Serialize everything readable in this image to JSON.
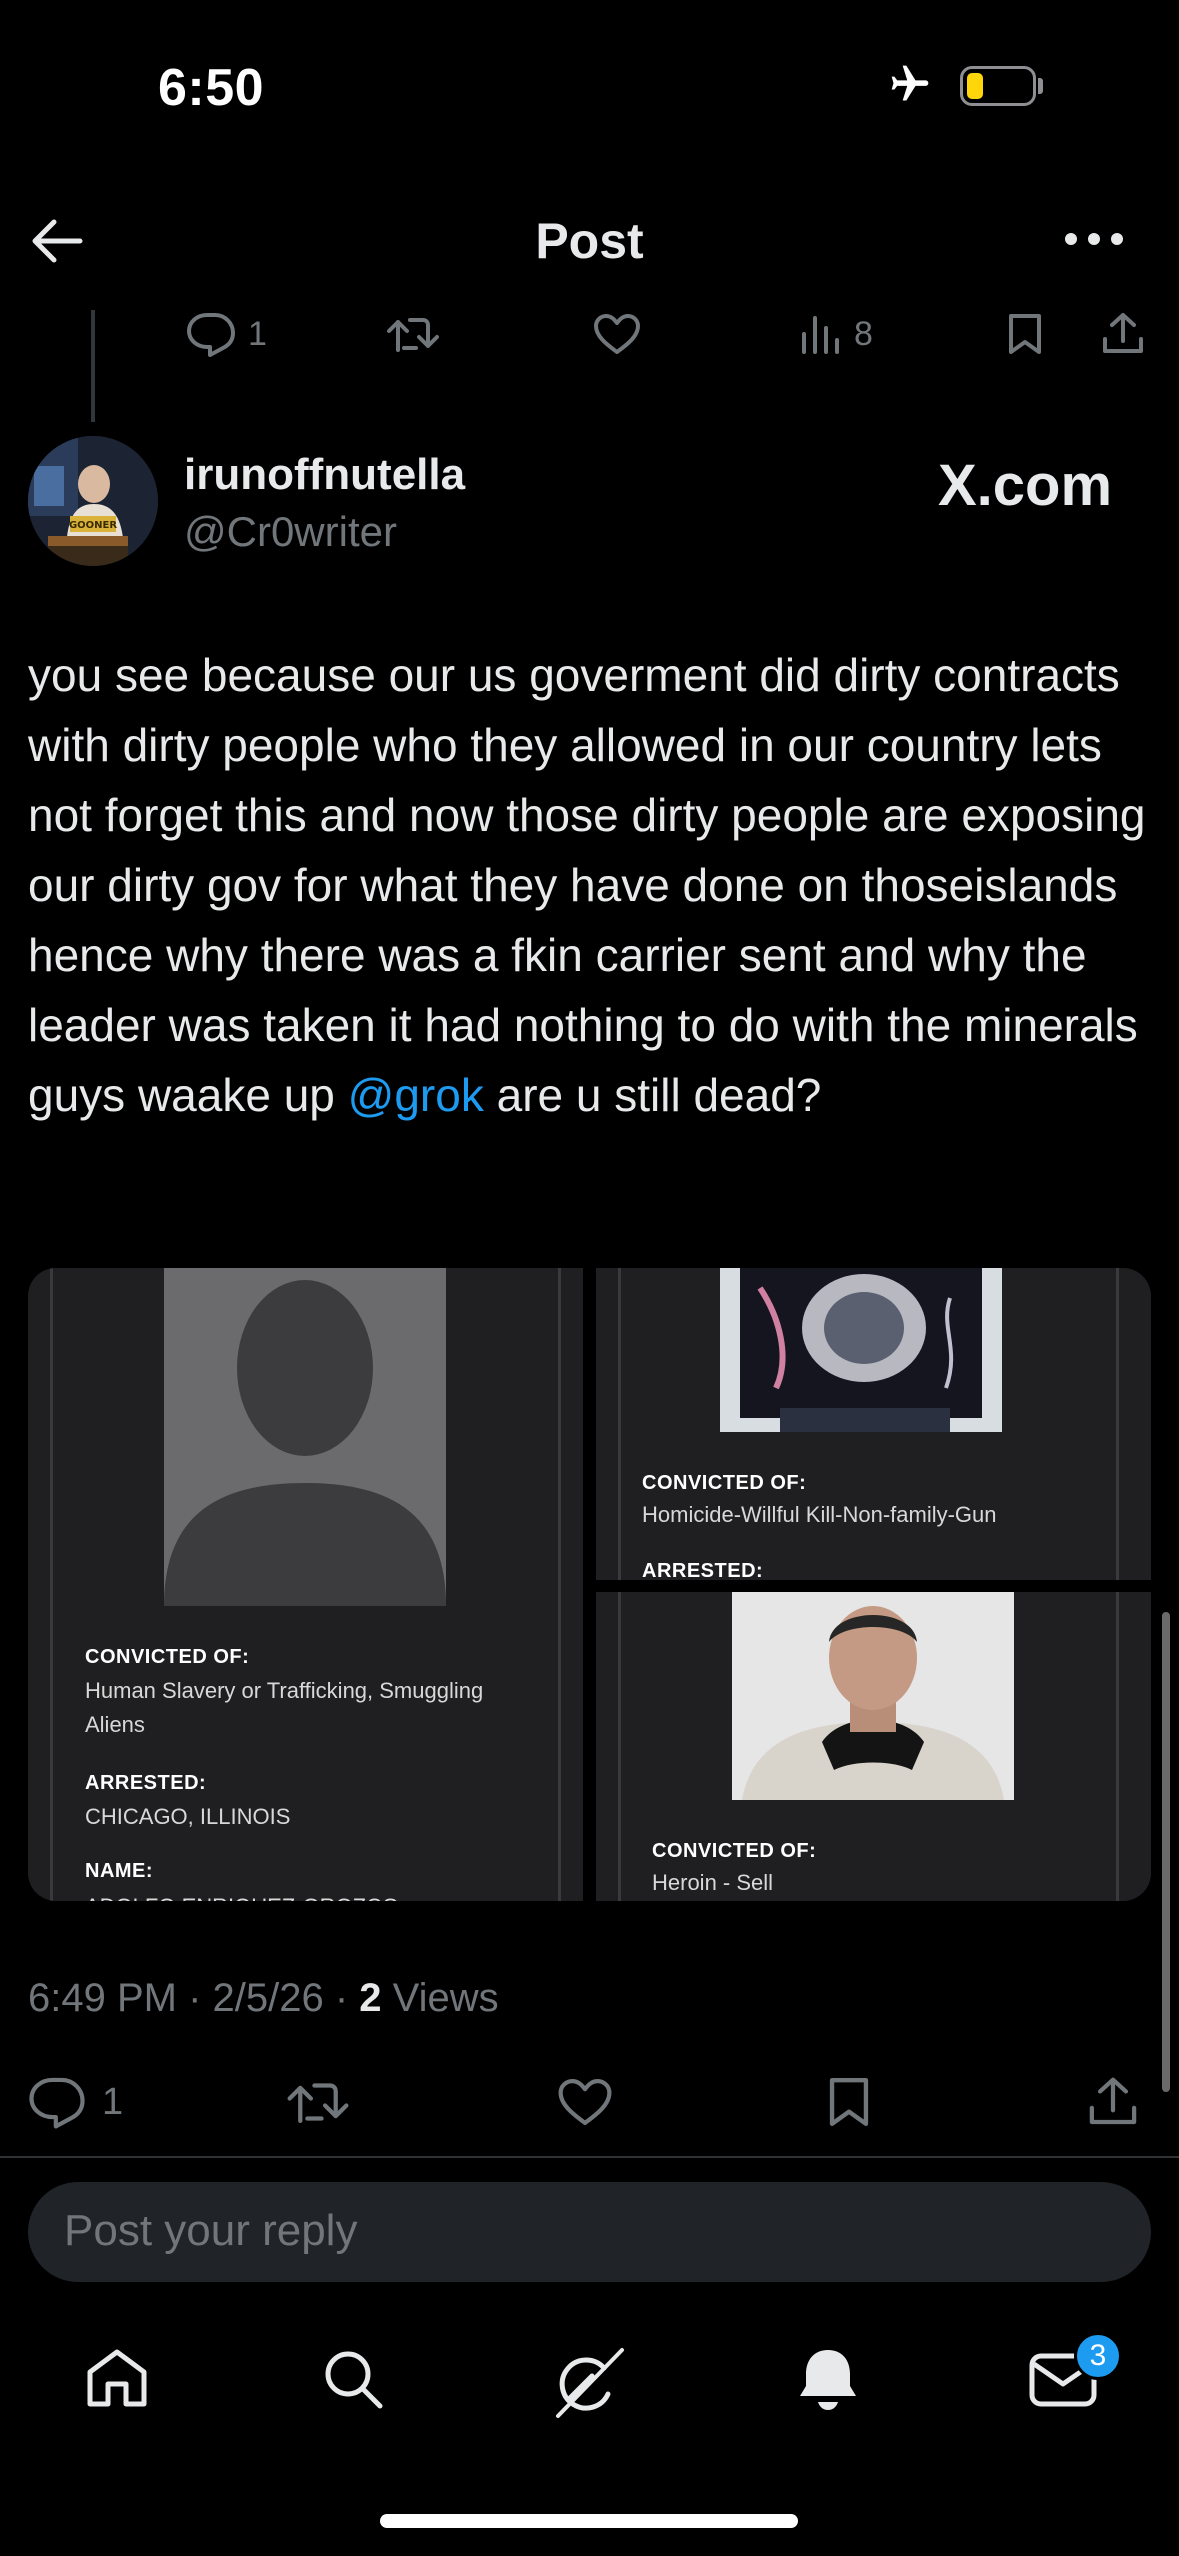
{
  "status_bar": {
    "time": "6:50",
    "battery_color": "#ffd60a"
  },
  "header": {
    "title": "Post"
  },
  "previous_post_actions": {
    "reply_count": "1",
    "views_count": "8"
  },
  "author": {
    "name": "irunoffnutella",
    "handle": "@Cr0writer",
    "avatar_label": "GOONER",
    "source_label": "X.com"
  },
  "tweet": {
    "text": "you see because our us goverment did dirty contracts with dirty people who they allowed in our country lets not forget this and now those dirty people are exposing our dirty gov for what they have done on thoseislands hence why there was a fkin carrier sent and why the leader was taken it had nothing to do with the minerals guys waake up ",
    "mention": "@grok",
    "text_end": " are u still dead?"
  },
  "media": {
    "card1": {
      "convicted_label": "CONVICTED OF:",
      "convicted_value_1": "Human Slavery or Trafficking, Smuggling",
      "convicted_value_2": "Aliens",
      "arrested_label": "ARRESTED:",
      "arrested_value": "CHICAGO, ILLINOIS",
      "name_label": "NAME:",
      "name_value": "ADOLFO ENRIQUEZ-OROZCO"
    },
    "card2": {
      "convicted_label": "CONVICTED OF:",
      "convicted_value": "Homicide-Willful Kill-Non-family-Gun",
      "arrested_label": "ARRESTED:"
    },
    "card3": {
      "convicted_label": "CONVICTED OF:",
      "convicted_value": "Heroin - Sell"
    }
  },
  "meta": {
    "time": "6:49 PM",
    "sep": " · ",
    "date": "2/5/26",
    "views_count": "2",
    "views_label": " Views"
  },
  "actions": {
    "reply_count": "1"
  },
  "reply": {
    "placeholder": "Post your reply"
  },
  "nav": {
    "messages_badge": "3"
  },
  "colors": {
    "accent": "#1d9bf0",
    "background": "#000000",
    "muted": "#71767b"
  }
}
